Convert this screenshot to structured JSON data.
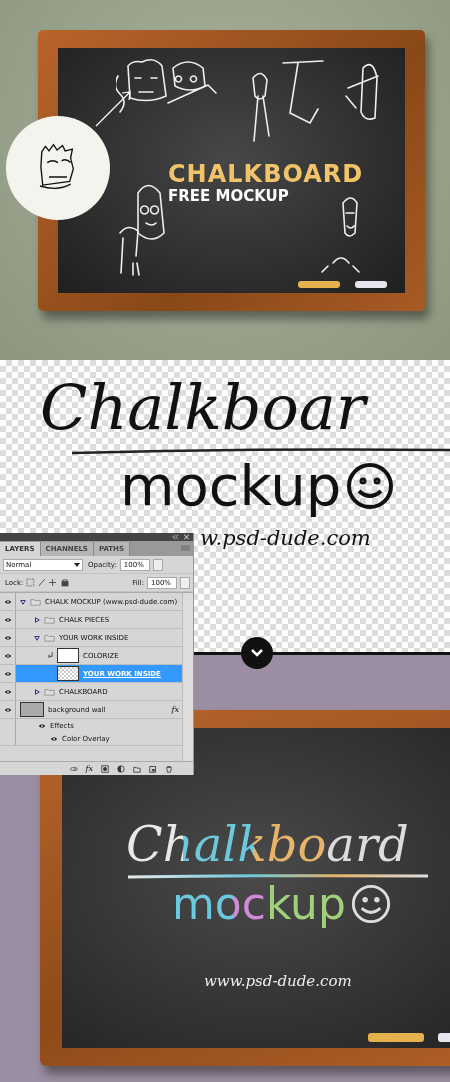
{
  "top_mockup": {
    "title": "CHALKBOARD",
    "subtitle": "FREE MOCKUP"
  },
  "preview": {
    "title": "Chalkboar",
    "subtitle": "mockup",
    "url": "w.psd-dude.com"
  },
  "layers_panel": {
    "tabs": [
      {
        "label": "LAYERS",
        "selected": true
      },
      {
        "label": "CHANNELS",
        "selected": false
      },
      {
        "label": "PATHS",
        "selected": false
      }
    ],
    "blend_mode": "Normal",
    "opacity_label": "Opacity:",
    "opacity": "100%",
    "lock_label": "Lock:",
    "fill_label": "Fill:",
    "fill": "100%",
    "layers": [
      {
        "name": "CHALK MOCKUP (www.psd-dude.com)",
        "kind": "group",
        "visible": true,
        "expanded": true,
        "selected": false,
        "children": [
          {
            "name": "CHALK PIECES",
            "kind": "group",
            "visible": true,
            "expanded": false,
            "selected": false
          },
          {
            "name": "YOUR WORK INSIDE",
            "kind": "group",
            "visible": true,
            "expanded": true,
            "selected": false,
            "children": [
              {
                "name": "COLORIZE",
                "kind": "adjustment",
                "visible": true,
                "clipped": true,
                "selected": false
              },
              {
                "name": "YOUR WORK INSIDE",
                "kind": "smart",
                "visible": true,
                "clipped": false,
                "selected": true
              }
            ]
          },
          {
            "name": "CHALKBOARD",
            "kind": "group",
            "visible": true,
            "expanded": false,
            "selected": false
          }
        ]
      },
      {
        "name": "background wall",
        "kind": "layer",
        "visible": true,
        "selected": false,
        "fx": "fx",
        "effects": {
          "label": "Effects",
          "visible": true,
          "items": [
            {
              "name": "Color Overlay",
              "visible": true
            }
          ]
        }
      }
    ],
    "footer_fx": "fx"
  },
  "result": {
    "title": "Chalkboard",
    "subtitle": "mockup",
    "url": "www.psd-dude.com"
  }
}
